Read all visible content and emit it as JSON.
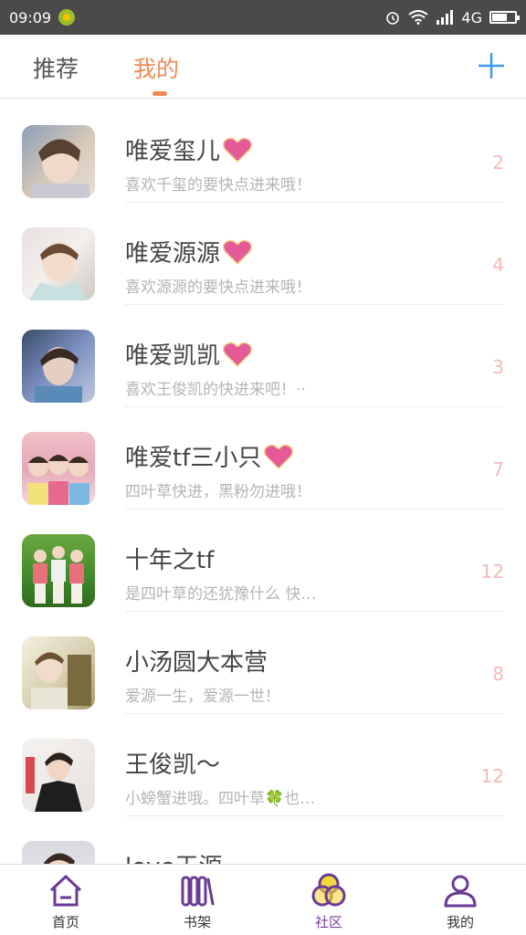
{
  "status": {
    "time": "09:09",
    "network": "4G"
  },
  "tabs": {
    "recommend": "推荐",
    "mine": "我的"
  },
  "groups": [
    {
      "title": "唯爱玺儿",
      "heart": true,
      "subtitle": "喜欢千玺的要快点进来哦！",
      "count": "2"
    },
    {
      "title": "唯爱源源",
      "heart": true,
      "subtitle": "喜欢源源的要快点进来哦！",
      "count": "4"
    },
    {
      "title": "唯爱凯凯",
      "heart": true,
      "subtitle": "喜欢王俊凯的快进来吧！··",
      "count": "3"
    },
    {
      "title": "唯爱tf三小只",
      "heart": true,
      "subtitle": "四叶草快进，黑粉勿进哦！",
      "count": "7"
    },
    {
      "title": "十年之tf",
      "heart": false,
      "subtitle": "是四叶草的还犹豫什么 快…",
      "count": "12"
    },
    {
      "title": "小汤圆大本营",
      "heart": false,
      "subtitle": "爱源一生，爱源一世！",
      "count": "8"
    },
    {
      "title": "王俊凯～",
      "heart": false,
      "subtitle": "小螃蟹进哦。四叶草🍀也…",
      "count": "12"
    },
    {
      "title": "love王源",
      "heart": false,
      "subtitle": "",
      "count": ""
    }
  ],
  "nav": [
    {
      "label": "首页",
      "icon": "home-icon",
      "active": false
    },
    {
      "label": "书架",
      "icon": "bookshelf-icon",
      "active": false
    },
    {
      "label": "社区",
      "icon": "community-icon",
      "active": true
    },
    {
      "label": "我的",
      "icon": "profile-icon",
      "active": false
    }
  ],
  "colors": {
    "accent": "#f08a55",
    "nav_active": "#7b3fa0",
    "count": "#f7b8b8"
  }
}
